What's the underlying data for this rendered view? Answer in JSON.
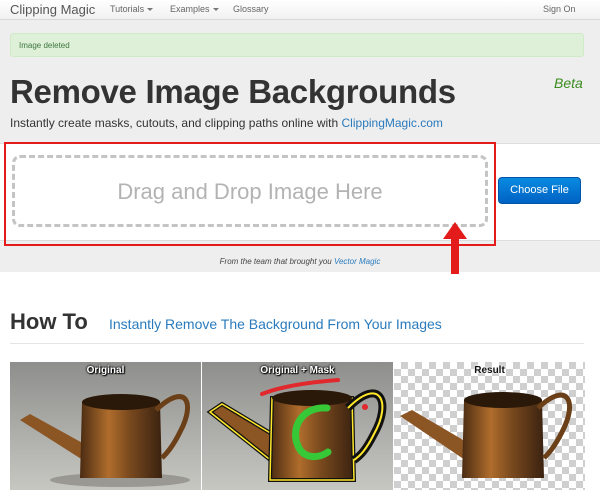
{
  "nav": {
    "brand": "Clipping Magic",
    "tutorials": "Tutorials",
    "examples": "Examples",
    "glossary": "Glossary",
    "sign_on": "Sign On"
  },
  "alert": {
    "message": "Image deleted"
  },
  "hero": {
    "title": "Remove Image Backgrounds",
    "beta": "Beta",
    "subtitle_prefix": "Instantly create masks, cutouts, and clipping paths online with ",
    "subtitle_link": "ClippingMagic.com"
  },
  "upload": {
    "drop_text": "Drag and Drop Image Here",
    "choose_button": "Choose File"
  },
  "credit": {
    "prefix": "From the team that brought you ",
    "link": "Vector Magic"
  },
  "howto": {
    "heading": "How To",
    "subheading": "Instantly Remove The Background From Your Images",
    "panels": [
      {
        "label": "Original"
      },
      {
        "label": "Original + Mask"
      },
      {
        "label": "Result"
      }
    ]
  },
  "colors": {
    "accent_link": "#2a7bbd",
    "highlight_frame": "#e41b1b",
    "primary_button": "#0a7ad6",
    "alert_bg": "#dff0d8",
    "beta": "#3a8c1f"
  },
  "icons": [
    "chevron-down-icon",
    "red-arrow-icon"
  ]
}
